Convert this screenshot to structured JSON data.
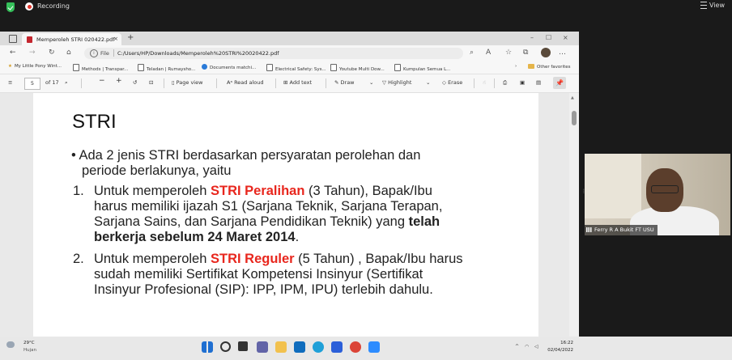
{
  "meeting": {
    "recording_label": "Recording",
    "view_label": "View"
  },
  "browser": {
    "tab_title": "Memperoleh STRI 020422.pdf",
    "tab_close": "×",
    "new_tab": "+",
    "window_controls": [
      "–",
      "☐",
      "×"
    ],
    "file_label": "File",
    "url": "C:/Users/HP/Downloads/Memperoleh%20STRI%20020422.pdf",
    "bookmarks": [
      "My Little Pony Wint...",
      "Methods | Transpar...",
      "Teladan | Rumaysho...",
      "Documents matchi...",
      "Electrical Safety: Sys...",
      "Youtube Multi Dow...",
      "Kumpulan Semua L..."
    ],
    "other_favorites": "Other favorites"
  },
  "pdf_toolbar": {
    "page_number": "5",
    "page_count": "of 17",
    "page_view": "Page view",
    "read_aloud": "Read aloud",
    "add_text": "Add text",
    "draw": "Draw",
    "highlight": "Highlight",
    "erase": "Erase"
  },
  "slide": {
    "title": "STRI",
    "intro_line1": "Ada 2 jenis STRI berdasarkan persyaratan perolehan dan",
    "intro_line2": "periode berlakunya, yaitu",
    "item1": {
      "num": "1.",
      "pre": "Untuk memperoleh ",
      "highlight": "STRI Peralihan",
      "post": " (3 Tahun), Bapak/Ibu",
      "line2": "harus memiliki ijazah S1 (Sarjana Teknik, Sarjana Terapan,",
      "line3_pre": "Sarjana Sains, dan Sarjana Pendidikan Teknik) yang ",
      "line3_bold": "telah",
      "line4_bold": "berkerja sebelum 24 Maret 2014",
      "line4_post": "."
    },
    "item2": {
      "num": "2.",
      "pre": "Untuk memperoleh ",
      "highlight": "STRI Reguler",
      "post": " (5 Tahun) , Bapak/Ibu harus",
      "line2": "sudah memiliki Sertifikat Kompetensi Insinyur (Sertifikat",
      "line3": "Insinyur Profesional (SIP): IPP, IPM, IPU) terlebih dahulu."
    }
  },
  "participant": {
    "name": "Ferry R A Bukit FT USU"
  },
  "taskbar": {
    "temperature": "29°C",
    "weather": "Hujan",
    "time": "16:22",
    "date": "02/04/2022"
  },
  "colors": {
    "highlight_red": "#e8261d",
    "pdf_icon": "#c4262e"
  }
}
